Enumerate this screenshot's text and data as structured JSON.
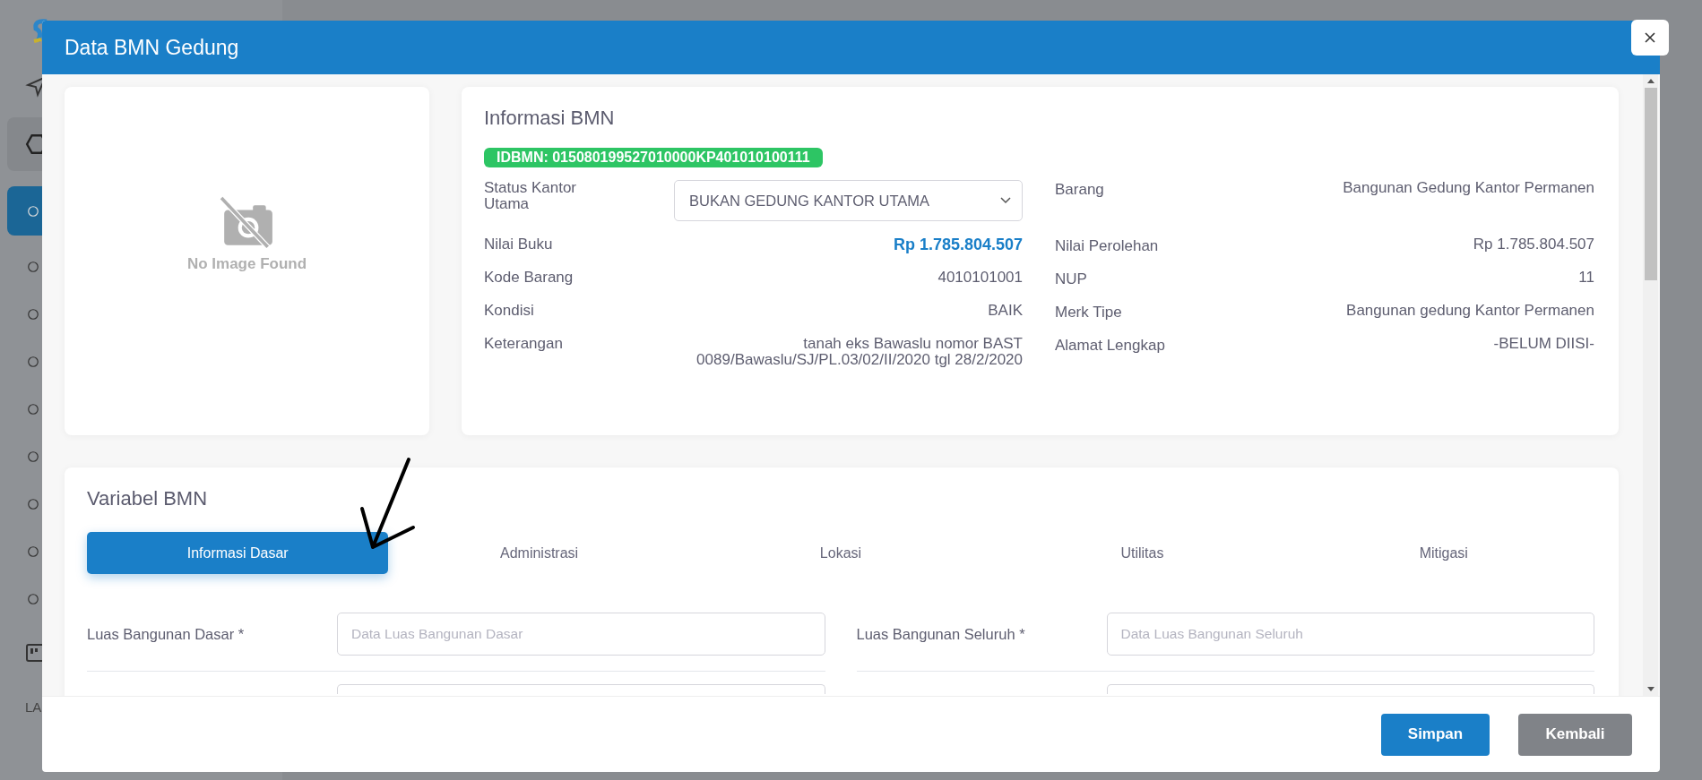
{
  "sidebar": {
    "items": [
      {
        "selected": false
      },
      {
        "selected": false
      },
      {
        "selected": true
      },
      {
        "selected": false
      },
      {
        "selected": false
      },
      {
        "selected": false
      },
      {
        "selected": false
      },
      {
        "selected": false
      },
      {
        "selected": false
      },
      {
        "selected": false
      },
      {
        "selected": false
      }
    ],
    "section_label": "LA"
  },
  "dialog": {
    "title": "Data BMN Gedung",
    "image_placeholder": "No Image Found",
    "info": {
      "title": "Informasi BMN",
      "id_badge": "IDBMN: 015080199527010000KP401010100111",
      "rows": [
        {
          "left": {
            "label": "Status Kantor Utama",
            "value": "BUKAN GEDUNG KANTOR UTAMA",
            "kind": "select"
          },
          "right": {
            "label": "Barang",
            "value": "Bangunan Gedung Kantor Permanen"
          }
        },
        {
          "left": {
            "label": "Nilai Buku",
            "value": "Rp 1.785.804.507",
            "kind": "highlight"
          },
          "right": {
            "label": "Nilai Perolehan",
            "value": "Rp 1.785.804.507"
          }
        },
        {
          "left": {
            "label": "Kode Barang",
            "value": "4010101001",
            "kind": "text"
          },
          "right": {
            "label": "NUP",
            "value": "11"
          }
        },
        {
          "left": {
            "label": "Kondisi",
            "value": "BAIK",
            "kind": "text"
          },
          "right": {
            "label": "Merk Tipe",
            "value": "Bangunan gedung Kantor Permanen"
          }
        },
        {
          "left": {
            "label": "Keterangan",
            "value": "tanah eks Bawaslu nomor BAST 0089/Bawaslu/SJ/PL.03/02/II/2020 tgl 28/2/2020",
            "kind": "text"
          },
          "right": {
            "label": "Alamat Lengkap",
            "value": "-BELUM DIISI-"
          }
        }
      ]
    },
    "variables": {
      "title": "Variabel BMN",
      "tabs": [
        {
          "label": "Informasi Dasar",
          "selected": true
        },
        {
          "label": "Administrasi",
          "selected": false
        },
        {
          "label": "Lokasi",
          "selected": false
        },
        {
          "label": "Utilitas",
          "selected": false
        },
        {
          "label": "Mitigasi",
          "selected": false
        }
      ],
      "fields": [
        {
          "label": "Luas Bangunan Dasar *",
          "placeholder": "Data Luas Bangunan Dasar"
        },
        {
          "label": "Luas Bangunan Seluruh *",
          "placeholder": "Data Luas Bangunan Seluruh"
        }
      ]
    },
    "buttons": [
      {
        "label": "Simpan",
        "kind": "primary"
      },
      {
        "label": "Kembali",
        "kind": "secondary"
      }
    ]
  }
}
